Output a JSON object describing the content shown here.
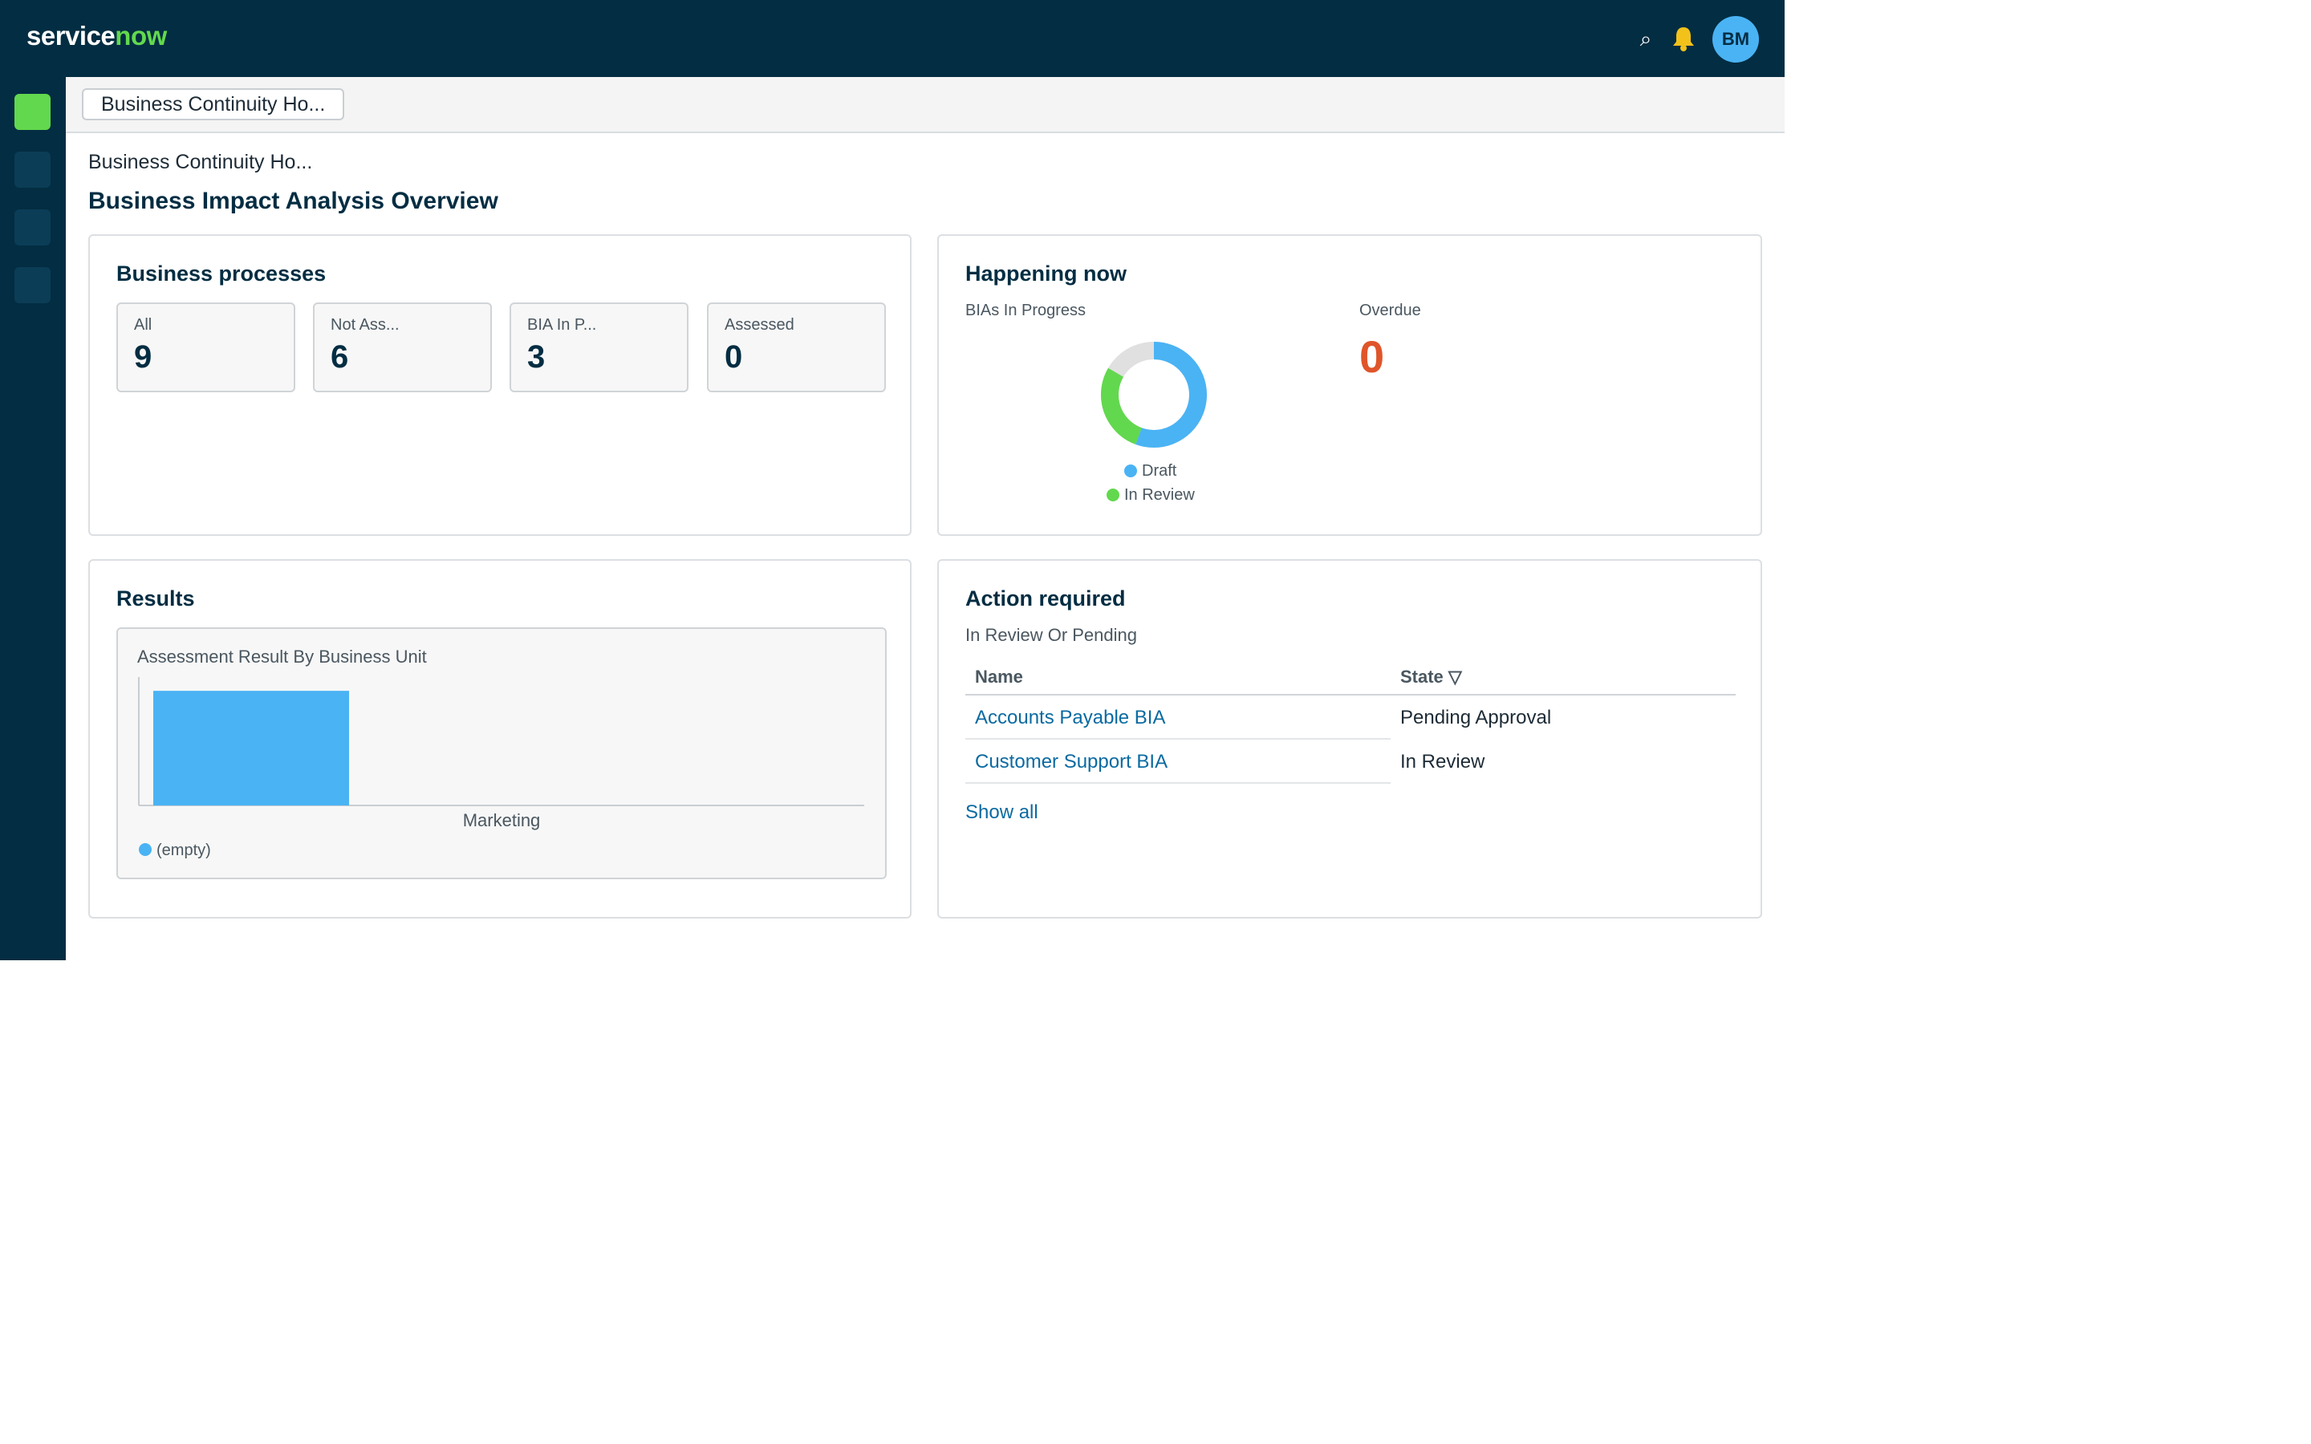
{
  "brand": {
    "logo_part1": "service",
    "logo_part2": "now"
  },
  "header": {
    "search_icon": "search-icon",
    "bell_icon": "bell-icon",
    "avatar_initials": "BM"
  },
  "rail": {
    "items": [
      "rail-item-home",
      "rail-item-1",
      "rail-item-2",
      "rail-item-3"
    ],
    "active_index": 0
  },
  "tabs": [
    {
      "label": "Business Continuity Ho..."
    }
  ],
  "page": {
    "breadcrumb": "Business Continuity Ho...",
    "title": "Business Impact Analysis Overview"
  },
  "business_processes": {
    "title": "Business processes",
    "stats": [
      {
        "label": "All",
        "value": "9"
      },
      {
        "label": "Not Ass...",
        "value": "6"
      },
      {
        "label": "BIA In P...",
        "value": "3"
      },
      {
        "label": "Assessed",
        "value": "0"
      }
    ]
  },
  "happening_now": {
    "title": "Happening now",
    "in_progress_label": "BIAs In Progress",
    "overdue_label": "Overdue",
    "overdue_value": "0",
    "legend": [
      {
        "label": "Draft",
        "color": "#4ab3f4"
      },
      {
        "label": "In Review",
        "color": "#62d84e"
      }
    ]
  },
  "results": {
    "title": "Results",
    "chart_title": "Assessment Result By Business Unit"
  },
  "chart_data": [
    {
      "type": "pie",
      "title": "BIAs In Progress",
      "labels": [
        "Draft",
        "In Review"
      ],
      "values": [
        2,
        1
      ],
      "colors": [
        "#4ab3f4",
        "#62d84e"
      ],
      "track_color": "#e0e0e0",
      "legend": "bottom"
    },
    {
      "type": "bar",
      "title": "Assessment Result By Business Unit",
      "categories": [
        "Marketing"
      ],
      "series": [
        {
          "name": "(empty)",
          "values": [
            1
          ],
          "color": "#4ab3f4"
        }
      ],
      "ylim": [
        0,
        1.12
      ],
      "legend": "bottom-left",
      "grid": false
    }
  ],
  "action_required": {
    "title": "Action required",
    "subtitle": "In Review Or Pending",
    "columns": {
      "name": "Name",
      "state": "State ▽"
    },
    "rows": [
      {
        "name": "Accounts Payable BIA",
        "state": "Pending Approval"
      },
      {
        "name": "Customer Support BIA",
        "state": "In Review"
      }
    ],
    "show_all": "Show all"
  }
}
